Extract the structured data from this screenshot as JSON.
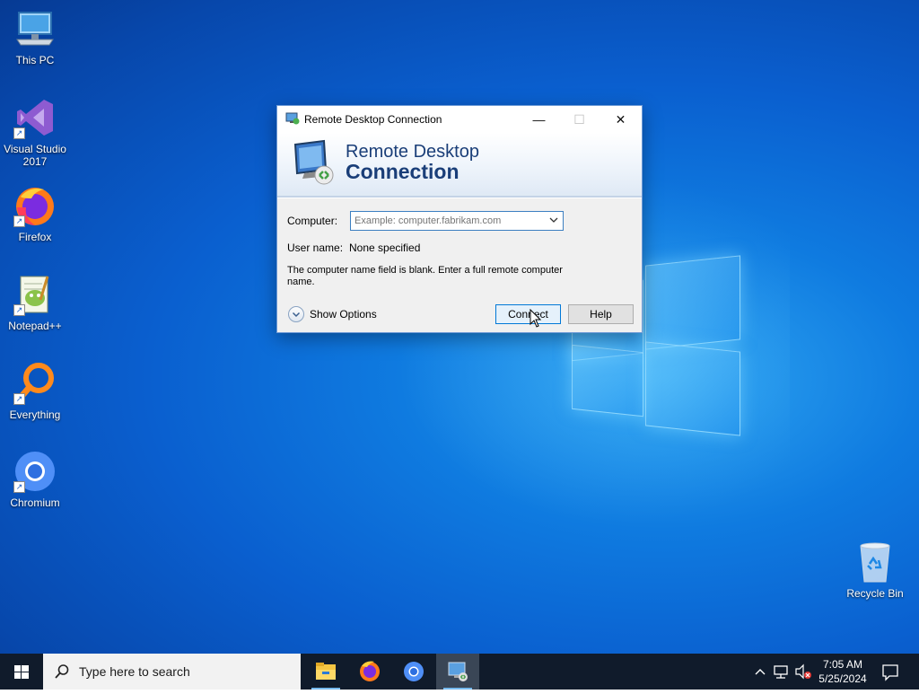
{
  "desktop": {
    "icons": [
      {
        "label": "This PC",
        "icon": "computer-icon"
      },
      {
        "label": "Visual Studio\n2017",
        "icon": "visual-studio-icon"
      },
      {
        "label": "Firefox",
        "icon": "firefox-icon"
      },
      {
        "label": "Notepad++",
        "icon": "notepadpp-icon"
      },
      {
        "label": "Everything",
        "icon": "everything-search-icon"
      },
      {
        "label": "Chromium",
        "icon": "chromium-icon"
      },
      {
        "label": "Recycle Bin",
        "icon": "recycle-bin-icon"
      }
    ]
  },
  "dialog": {
    "title": "Remote Desktop Connection",
    "banner_line1": "Remote Desktop",
    "banner_line2": "Connection",
    "computer_label": "Computer:",
    "computer_placeholder": "Example: computer.fabrikam.com",
    "computer_value": "",
    "username_label": "User name:",
    "username_value": "None specified",
    "message": "The computer name field is blank. Enter a full remote computer name.",
    "show_options": "Show Options",
    "connect": "Connect",
    "help": "Help",
    "minimize_glyph": "—",
    "maximize_glyph": "☐",
    "close_glyph": "✕"
  },
  "taskbar": {
    "search_placeholder": "Type here to search",
    "apps": [
      {
        "name": "File Explorer",
        "icon": "file-explorer-icon"
      },
      {
        "name": "Firefox",
        "icon": "firefox-icon"
      },
      {
        "name": "Chromium",
        "icon": "chromium-icon"
      },
      {
        "name": "Remote Desktop Connection",
        "icon": "remote-desktop-icon",
        "active": true
      }
    ],
    "time": "7:05 AM",
    "date": "5/25/2024"
  },
  "colors": {
    "accent": "#0078d7",
    "taskbar": "#101b2b",
    "banner_text": "#1a3e78"
  }
}
